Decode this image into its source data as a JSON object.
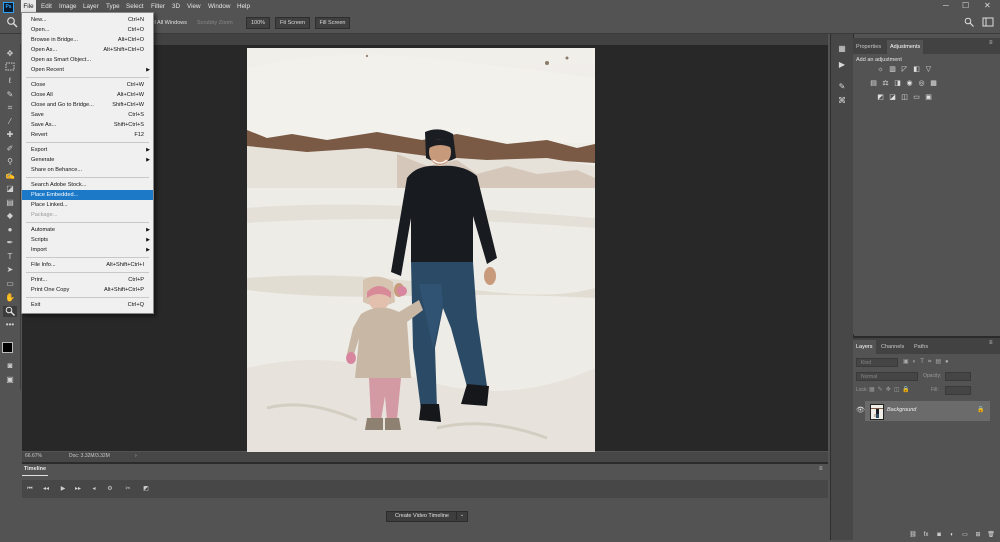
{
  "app": {
    "logo": "Ps"
  },
  "menubar": {
    "items": [
      "File",
      "Edit",
      "Image",
      "Layer",
      "Type",
      "Select",
      "Filter",
      "3D",
      "View",
      "Window",
      "Help"
    ],
    "window_controls": [
      "─",
      "☐",
      "✕"
    ]
  },
  "options_bar": {
    "scroll_all_windows": "Scroll All Windows",
    "scrubby_zoom": "Scrubby Zoom",
    "zoom_100": "100%",
    "fit_screen": "Fit Screen",
    "fill_screen": "Fill Screen"
  },
  "file_menu": {
    "groups": [
      [
        {
          "label": "New...",
          "shortcut": "Ctrl+N"
        },
        {
          "label": "Open...",
          "shortcut": "Ctrl+O"
        },
        {
          "label": "Browse in Bridge...",
          "shortcut": "Alt+Ctrl+O"
        },
        {
          "label": "Open As...",
          "shortcut": "Alt+Shift+Ctrl+O"
        },
        {
          "label": "Open as Smart Object...",
          "shortcut": ""
        },
        {
          "label": "Open Recent",
          "shortcut": "",
          "submenu": true
        }
      ],
      [
        {
          "label": "Close",
          "shortcut": "Ctrl+W"
        },
        {
          "label": "Close All",
          "shortcut": "Alt+Ctrl+W"
        },
        {
          "label": "Close and Go to Bridge...",
          "shortcut": "Shift+Ctrl+W"
        },
        {
          "label": "Save",
          "shortcut": "Ctrl+S"
        },
        {
          "label": "Save As...",
          "shortcut": "Shift+Ctrl+S"
        },
        {
          "label": "Revert",
          "shortcut": "F12"
        }
      ],
      [
        {
          "label": "Export",
          "shortcut": "",
          "submenu": true
        },
        {
          "label": "Generate",
          "shortcut": "",
          "submenu": true
        },
        {
          "label": "Share on Behance...",
          "shortcut": ""
        }
      ],
      [
        {
          "label": "Search Adobe Stock...",
          "shortcut": ""
        },
        {
          "label": "Place Embedded...",
          "shortcut": "",
          "highlighted": true
        },
        {
          "label": "Place Linked...",
          "shortcut": ""
        },
        {
          "label": "Package...",
          "shortcut": "",
          "disabled": true
        }
      ],
      [
        {
          "label": "Automate",
          "shortcut": "",
          "submenu": true
        },
        {
          "label": "Scripts",
          "shortcut": "",
          "submenu": true
        },
        {
          "label": "Import",
          "shortcut": "",
          "submenu": true
        }
      ],
      [
        {
          "label": "File Info...",
          "shortcut": "Alt+Shift+Ctrl+I"
        }
      ],
      [
        {
          "label": "Print...",
          "shortcut": "Ctrl+P"
        },
        {
          "label": "Print One Copy",
          "shortcut": "Alt+Shift+Ctrl+P"
        }
      ],
      [
        {
          "label": "Exit",
          "shortcut": "Ctrl+Q"
        }
      ]
    ]
  },
  "status": {
    "zoom": "66.67%",
    "doc": "Doc: 3.32M/3.32M"
  },
  "timeline": {
    "tab": "Timeline",
    "create_button": "Create Video Timeline"
  },
  "adjustments_panel": {
    "tabs": [
      "Properties",
      "Adjustments"
    ],
    "active_tab": "Adjustments",
    "heading": "Add an adjustment"
  },
  "layers_panel": {
    "tabs": [
      "Layers",
      "Channels",
      "Paths"
    ],
    "active_tab": "Layers",
    "kind_placeholder": "Kind",
    "blend_mode": "Normal",
    "opacity_label": "Opacity:",
    "lock_label": "Lock:",
    "fill_label": "Fill:",
    "layer_name": "Background",
    "bottom_icons": [
      "link-icon",
      "fx-icon",
      "mask-icon",
      "adjustment-icon",
      "folder-icon",
      "new-layer-icon",
      "trash-icon"
    ]
  }
}
